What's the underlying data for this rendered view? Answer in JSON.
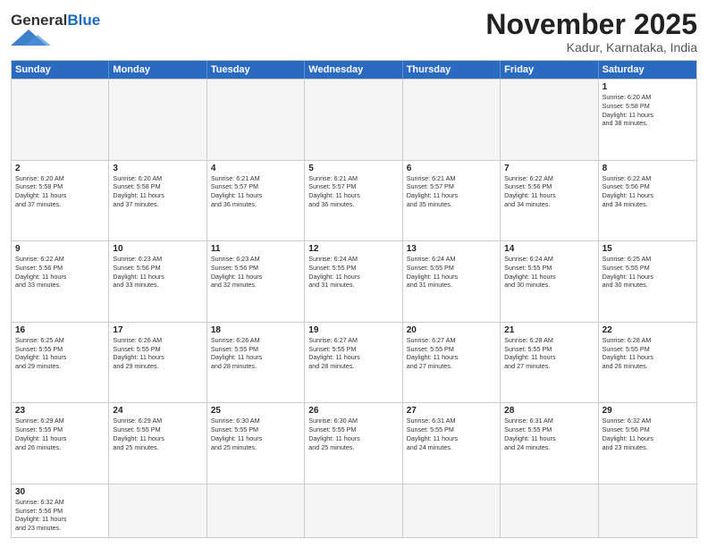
{
  "logo": {
    "text_general": "General",
    "text_blue": "Blue"
  },
  "header": {
    "month_title": "November 2025",
    "location": "Kadur, Karnataka, India"
  },
  "weekdays": [
    "Sunday",
    "Monday",
    "Tuesday",
    "Wednesday",
    "Thursday",
    "Friday",
    "Saturday"
  ],
  "rows": [
    [
      {
        "day": "",
        "empty": true,
        "lines": []
      },
      {
        "day": "",
        "empty": true,
        "lines": []
      },
      {
        "day": "",
        "empty": true,
        "lines": []
      },
      {
        "day": "",
        "empty": true,
        "lines": []
      },
      {
        "day": "",
        "empty": true,
        "lines": []
      },
      {
        "day": "",
        "empty": true,
        "lines": []
      },
      {
        "day": "1",
        "empty": false,
        "lines": [
          "Sunrise: 6:20 AM",
          "Sunset: 5:58 PM",
          "Daylight: 11 hours",
          "and 38 minutes."
        ]
      }
    ],
    [
      {
        "day": "2",
        "empty": false,
        "lines": [
          "Sunrise: 6:20 AM",
          "Sunset: 5:58 PM",
          "Daylight: 11 hours",
          "and 37 minutes."
        ]
      },
      {
        "day": "3",
        "empty": false,
        "lines": [
          "Sunrise: 6:20 AM",
          "Sunset: 5:58 PM",
          "Daylight: 11 hours",
          "and 37 minutes."
        ]
      },
      {
        "day": "4",
        "empty": false,
        "lines": [
          "Sunrise: 6:21 AM",
          "Sunset: 5:57 PM",
          "Daylight: 11 hours",
          "and 36 minutes."
        ]
      },
      {
        "day": "5",
        "empty": false,
        "lines": [
          "Sunrise: 6:21 AM",
          "Sunset: 5:57 PM",
          "Daylight: 11 hours",
          "and 36 minutes."
        ]
      },
      {
        "day": "6",
        "empty": false,
        "lines": [
          "Sunrise: 6:21 AM",
          "Sunset: 5:57 PM",
          "Daylight: 11 hours",
          "and 35 minutes."
        ]
      },
      {
        "day": "7",
        "empty": false,
        "lines": [
          "Sunrise: 6:22 AM",
          "Sunset: 5:56 PM",
          "Daylight: 11 hours",
          "and 34 minutes."
        ]
      },
      {
        "day": "8",
        "empty": false,
        "lines": [
          "Sunrise: 6:22 AM",
          "Sunset: 5:56 PM",
          "Daylight: 11 hours",
          "and 34 minutes."
        ]
      }
    ],
    [
      {
        "day": "9",
        "empty": false,
        "lines": [
          "Sunrise: 6:22 AM",
          "Sunset: 5:56 PM",
          "Daylight: 11 hours",
          "and 33 minutes."
        ]
      },
      {
        "day": "10",
        "empty": false,
        "lines": [
          "Sunrise: 6:23 AM",
          "Sunset: 5:56 PM",
          "Daylight: 11 hours",
          "and 33 minutes."
        ]
      },
      {
        "day": "11",
        "empty": false,
        "lines": [
          "Sunrise: 6:23 AM",
          "Sunset: 5:56 PM",
          "Daylight: 11 hours",
          "and 32 minutes."
        ]
      },
      {
        "day": "12",
        "empty": false,
        "lines": [
          "Sunrise: 6:24 AM",
          "Sunset: 5:55 PM",
          "Daylight: 11 hours",
          "and 31 minutes."
        ]
      },
      {
        "day": "13",
        "empty": false,
        "lines": [
          "Sunrise: 6:24 AM",
          "Sunset: 5:55 PM",
          "Daylight: 11 hours",
          "and 31 minutes."
        ]
      },
      {
        "day": "14",
        "empty": false,
        "lines": [
          "Sunrise: 6:24 AM",
          "Sunset: 5:55 PM",
          "Daylight: 11 hours",
          "and 30 minutes."
        ]
      },
      {
        "day": "15",
        "empty": false,
        "lines": [
          "Sunrise: 6:25 AM",
          "Sunset: 5:55 PM",
          "Daylight: 11 hours",
          "and 30 minutes."
        ]
      }
    ],
    [
      {
        "day": "16",
        "empty": false,
        "lines": [
          "Sunrise: 6:25 AM",
          "Sunset: 5:55 PM",
          "Daylight: 11 hours",
          "and 29 minutes."
        ]
      },
      {
        "day": "17",
        "empty": false,
        "lines": [
          "Sunrise: 6:26 AM",
          "Sunset: 5:55 PM",
          "Daylight: 11 hours",
          "and 29 minutes."
        ]
      },
      {
        "day": "18",
        "empty": false,
        "lines": [
          "Sunrise: 6:26 AM",
          "Sunset: 5:55 PM",
          "Daylight: 11 hours",
          "and 28 minutes."
        ]
      },
      {
        "day": "19",
        "empty": false,
        "lines": [
          "Sunrise: 6:27 AM",
          "Sunset: 5:55 PM",
          "Daylight: 11 hours",
          "and 28 minutes."
        ]
      },
      {
        "day": "20",
        "empty": false,
        "lines": [
          "Sunrise: 6:27 AM",
          "Sunset: 5:55 PM",
          "Daylight: 11 hours",
          "and 27 minutes."
        ]
      },
      {
        "day": "21",
        "empty": false,
        "lines": [
          "Sunrise: 6:28 AM",
          "Sunset: 5:55 PM",
          "Daylight: 11 hours",
          "and 27 minutes."
        ]
      },
      {
        "day": "22",
        "empty": false,
        "lines": [
          "Sunrise: 6:28 AM",
          "Sunset: 5:55 PM",
          "Daylight: 11 hours",
          "and 26 minutes."
        ]
      }
    ],
    [
      {
        "day": "23",
        "empty": false,
        "lines": [
          "Sunrise: 6:29 AM",
          "Sunset: 5:55 PM",
          "Daylight: 11 hours",
          "and 26 minutes."
        ]
      },
      {
        "day": "24",
        "empty": false,
        "lines": [
          "Sunrise: 6:29 AM",
          "Sunset: 5:55 PM",
          "Daylight: 11 hours",
          "and 25 minutes."
        ]
      },
      {
        "day": "25",
        "empty": false,
        "lines": [
          "Sunrise: 6:30 AM",
          "Sunset: 5:55 PM",
          "Daylight: 11 hours",
          "and 25 minutes."
        ]
      },
      {
        "day": "26",
        "empty": false,
        "lines": [
          "Sunrise: 6:30 AM",
          "Sunset: 5:55 PM",
          "Daylight: 11 hours",
          "and 25 minutes."
        ]
      },
      {
        "day": "27",
        "empty": false,
        "lines": [
          "Sunrise: 6:31 AM",
          "Sunset: 5:55 PM",
          "Daylight: 11 hours",
          "and 24 minutes."
        ]
      },
      {
        "day": "28",
        "empty": false,
        "lines": [
          "Sunrise: 6:31 AM",
          "Sunset: 5:55 PM",
          "Daylight: 11 hours",
          "and 24 minutes."
        ]
      },
      {
        "day": "29",
        "empty": false,
        "lines": [
          "Sunrise: 6:32 AM",
          "Sunset: 5:56 PM",
          "Daylight: 11 hours",
          "and 23 minutes."
        ]
      }
    ],
    [
      {
        "day": "30",
        "empty": false,
        "lines": [
          "Sunrise: 6:32 AM",
          "Sunset: 5:56 PM",
          "Daylight: 11 hours",
          "and 23 minutes."
        ]
      },
      {
        "day": "",
        "empty": true,
        "lines": []
      },
      {
        "day": "",
        "empty": true,
        "lines": []
      },
      {
        "day": "",
        "empty": true,
        "lines": []
      },
      {
        "day": "",
        "empty": true,
        "lines": []
      },
      {
        "day": "",
        "empty": true,
        "lines": []
      },
      {
        "day": "",
        "empty": true,
        "lines": []
      }
    ]
  ]
}
